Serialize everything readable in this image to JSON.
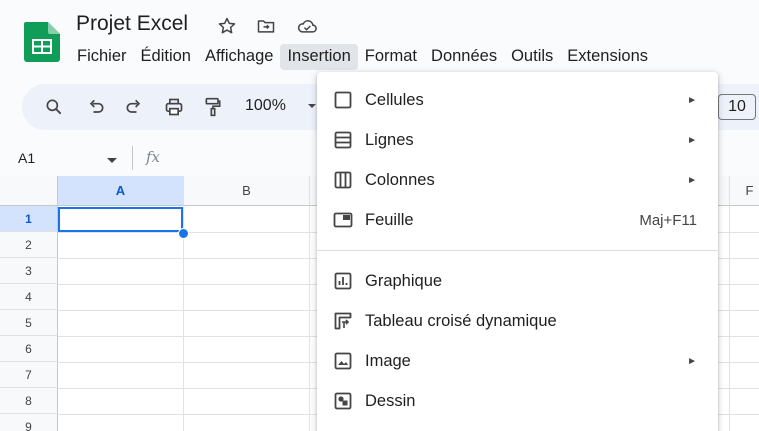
{
  "colors": {
    "accent": "#1a73e8",
    "sheets_green": "#0f9d58",
    "highlight_border": "#e0464a"
  },
  "header": {
    "title": "Projet Excel",
    "icons": [
      "star-icon",
      "move-to-folder-icon",
      "cloud-status-icon"
    ]
  },
  "menubar": {
    "items": [
      "Fichier",
      "Édition",
      "Affichage",
      "Insertion",
      "Format",
      "Données",
      "Outils",
      "Extensions"
    ],
    "active": "Insertion"
  },
  "toolbar": {
    "icons": [
      "search-icon",
      "undo-icon",
      "redo-icon",
      "print-icon",
      "paint-format-icon"
    ],
    "zoom": "100%",
    "font_size": "10"
  },
  "formula_bar": {
    "name_box": "A1",
    "fx": "fx"
  },
  "grid": {
    "columns": [
      "A",
      "B",
      "F"
    ],
    "rows": [
      "1",
      "2",
      "3",
      "4",
      "5",
      "6",
      "7",
      "8",
      "9"
    ],
    "selected_cell": "A1"
  },
  "insert_menu": {
    "items": [
      {
        "label": "Cellules",
        "icon": "cells-icon",
        "submenu": "►"
      },
      {
        "label": "Lignes",
        "icon": "rows-icon",
        "submenu": "►"
      },
      {
        "label": "Colonnes",
        "icon": "columns-icon",
        "submenu": "►"
      },
      {
        "label": "Feuille",
        "icon": "sheet-icon",
        "shortcut": "Maj+F11"
      },
      {
        "label": "Graphique",
        "icon": "chart-icon"
      },
      {
        "label": "Tableau croisé dynamique",
        "icon": "pivot-table-icon"
      },
      {
        "label": "Image",
        "icon": "image-icon",
        "submenu": "►"
      },
      {
        "label": "Dessin",
        "icon": "drawing-icon",
        "highlighted": true
      }
    ]
  }
}
